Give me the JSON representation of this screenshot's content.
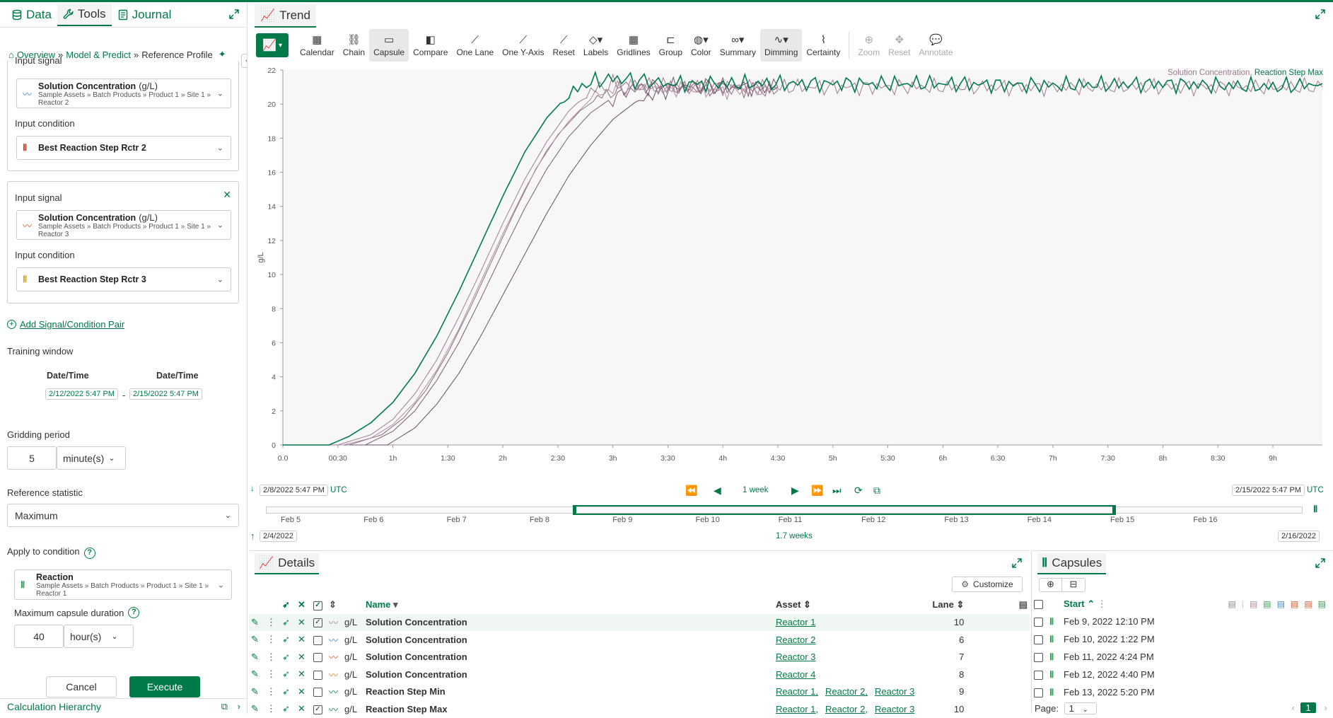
{
  "left": {
    "tabs": [
      {
        "label": "Data"
      },
      {
        "label": "Tools"
      },
      {
        "label": "Journal"
      }
    ],
    "breadcrumb": {
      "overview": "Overview",
      "model": "Model & Predict",
      "sep": "»",
      "current": "Reference Profile"
    },
    "card1": {
      "input_signal_label": "Input signal",
      "signal_name": "Solution Concentration",
      "signal_unit": "(g/L)",
      "signal_path": "Sample Assets » Batch Products » Product 1 » Site 1 » Reactor 2",
      "input_condition_label": "Input condition",
      "condition_name": "Best Reaction Step Rctr 2"
    },
    "card2": {
      "input_signal_label": "Input signal",
      "signal_name": "Solution Concentration",
      "signal_unit": "(g/L)",
      "signal_path": "Sample Assets » Batch Products » Product 1 » Site 1 » Reactor 3",
      "input_condition_label": "Input condition",
      "condition_name": "Best Reaction Step Rctr 3"
    },
    "add_pair": "Add Signal/Condition Pair",
    "training_window": {
      "label": "Training window",
      "col1": "Date/Time",
      "col2": "Date/Time",
      "start": "2/12/2022 5:47 PM",
      "dash": "-",
      "end": "2/15/2022 5:47 PM"
    },
    "gridding": {
      "label": "Gridding period",
      "value": "5",
      "unit": "minute(s)"
    },
    "reference_statistic": {
      "label": "Reference statistic",
      "value": "Maximum"
    },
    "apply_condition": {
      "label": "Apply to condition",
      "name": "Reaction",
      "path": "Sample Assets » Batch Products » Product 1 » Site 1 » Reactor 1"
    },
    "max_duration": {
      "label": "Maximum capsule duration",
      "value": "40",
      "unit": "hour(s)"
    },
    "cancel": "Cancel",
    "execute": "Execute",
    "calc_hierarchy": "Calculation Hierarchy"
  },
  "trend": {
    "tab_label": "Trend",
    "toolbar": [
      {
        "label": "Calendar",
        "icon": "calendar-icon",
        "glyph": "▦"
      },
      {
        "label": "Chain",
        "icon": "chain-icon",
        "glyph": "⛓"
      },
      {
        "label": "Capsule",
        "icon": "capsule-icon",
        "glyph": "▭",
        "active": true
      },
      {
        "label": "Compare",
        "icon": "compare-icon",
        "glyph": "◧"
      },
      {
        "label": "One Lane",
        "icon": "one-lane-icon",
        "glyph": "⟋"
      },
      {
        "label": "One Y-Axis",
        "icon": "one-y-axis-icon",
        "glyph": "⟋"
      },
      {
        "label": "Reset",
        "icon": "reset-icon",
        "glyph": "⟋"
      },
      {
        "label": "Labels",
        "icon": "labels-icon",
        "glyph": "◇▾"
      },
      {
        "label": "Gridlines",
        "icon": "gridlines-icon",
        "glyph": "▦"
      },
      {
        "label": "Group",
        "icon": "group-icon",
        "glyph": "⊏"
      },
      {
        "label": "Color",
        "icon": "color-icon",
        "glyph": "◍▾"
      },
      {
        "label": "Summary",
        "icon": "summary-icon",
        "glyph": "∞▾"
      },
      {
        "label": "Dimming",
        "icon": "dimming-icon",
        "glyph": "∿▾",
        "active": true
      },
      {
        "label": "Certainty",
        "icon": "certainty-icon",
        "glyph": "⌇"
      }
    ],
    "toolbar2": [
      {
        "label": "Zoom",
        "icon": "zoom-icon",
        "glyph": "⊕"
      },
      {
        "label": "Reset",
        "icon": "pan-reset-icon",
        "glyph": "✥"
      },
      {
        "label": "Annotate",
        "icon": "annotate-icon",
        "glyph": "💬"
      }
    ],
    "legend": {
      "item1": "Solution Concentration",
      "sep": ",",
      "item2": "Reaction Step Max",
      "color1": "#a07a90",
      "color2": "#007a49"
    },
    "nav": {
      "start": "2/8/2022 5:47 PM",
      "tz": "UTC",
      "span": "1 week",
      "end": "2/15/2022 5:47 PM",
      "tz2": "UTC",
      "overall_start": "2/4/2022",
      "overall_end": "2/16/2022",
      "overall_span": "1.7 weeks"
    },
    "overview_ticks": [
      "Feb 5",
      "Feb 6",
      "Feb 7",
      "Feb 8",
      "Feb 9",
      "Feb 10",
      "Feb 11",
      "Feb 12",
      "Feb 13",
      "Feb 14",
      "Feb 15",
      "Feb 16"
    ]
  },
  "chart_data": {
    "type": "line",
    "ylabel": "g/L",
    "ylim": [
      0,
      22
    ],
    "yticks": [
      0,
      2,
      4,
      6,
      8,
      10,
      12,
      14,
      16,
      18,
      20,
      22
    ],
    "xticks": [
      "0.0",
      "00:30",
      "1h",
      "1:30",
      "2h",
      "2:30",
      "3h",
      "3:30",
      "4h",
      "4:30",
      "5h",
      "5:30",
      "6h",
      "6:30",
      "7h",
      "7:30",
      "8h",
      "8:30",
      "9h"
    ],
    "xlim_hours": [
      0,
      9.45
    ],
    "series": [
      {
        "name": "Reaction Step Max",
        "color": "#007a49",
        "x": [
          0,
          0.42,
          0.6,
          0.8,
          1.0,
          1.2,
          1.4,
          1.6,
          1.8,
          2.0,
          2.2,
          2.4,
          2.6,
          2.8,
          3.0,
          3.2,
          3.5,
          4.0,
          5.0,
          6.0,
          7.0,
          8.0,
          9.0,
          9.45
        ],
        "y": [
          0,
          0,
          0.5,
          1.3,
          2.5,
          4.2,
          6.4,
          9.0,
          11.8,
          14.6,
          17.2,
          19.2,
          20.6,
          21.3,
          21.5,
          21.4,
          21.2,
          21.2,
          21.2,
          21.2,
          21.1,
          21.2,
          21.0,
          21.2
        ]
      },
      {
        "name": "Solution Concentration",
        "color": "#a07a90",
        "x": [
          0,
          0.5,
          0.8,
          1.0,
          1.2,
          1.4,
          1.6,
          1.8,
          2.0,
          2.2,
          2.4,
          2.6,
          2.8,
          3.0,
          3.2,
          3.5,
          4.0,
          5.0,
          6.0,
          7.0,
          8.0,
          9.0,
          9.45
        ],
        "y": [
          0,
          0,
          0.6,
          1.5,
          3.0,
          5.0,
          7.5,
          10.2,
          13.0,
          15.6,
          17.8,
          19.6,
          20.8,
          21.2,
          21.1,
          21.0,
          21.0,
          21.0,
          21.0,
          21.0,
          21.0,
          21.0,
          21.0
        ]
      },
      {
        "name": "Solution Concentration",
        "color": "#b08aa0",
        "x": [
          0,
          0.55,
          0.8,
          1.0,
          1.2,
          1.4,
          1.6,
          1.8,
          2.0,
          2.2,
          2.4,
          2.6,
          2.8,
          3.0,
          3.2,
          3.5,
          4.0,
          4.5
        ],
        "y": [
          0,
          0,
          0.4,
          1.2,
          2.5,
          4.4,
          6.8,
          9.6,
          12.4,
          15.0,
          17.3,
          19.0,
          20.3,
          20.9,
          21.0,
          20.9,
          20.8,
          20.8
        ]
      },
      {
        "name": "Solution Concentration",
        "color": "#8a6a80",
        "x": [
          0,
          0.6,
          0.9,
          1.1,
          1.3,
          1.5,
          1.7,
          1.9,
          2.1,
          2.3,
          2.5,
          2.7,
          2.9,
          3.1,
          3.3,
          3.6,
          4.0,
          4.5
        ],
        "y": [
          0,
          0,
          0.6,
          1.6,
          3.2,
          5.4,
          8.0,
          10.8,
          13.6,
          16.2,
          18.2,
          19.6,
          20.5,
          20.9,
          21.0,
          20.9,
          20.9,
          20.8
        ]
      },
      {
        "name": "Solution Concentration",
        "color": "#7a5a70",
        "x": [
          0,
          0.75,
          1.0,
          1.2,
          1.4,
          1.6,
          1.8,
          2.0,
          2.2,
          2.4,
          2.6,
          2.8,
          3.0,
          3.2,
          3.4,
          3.7,
          4.0,
          4.5
        ],
        "y": [
          0,
          0,
          0.8,
          2.0,
          3.8,
          6.0,
          8.6,
          11.3,
          13.9,
          16.2,
          18.1,
          19.5,
          20.4,
          20.9,
          21.1,
          21.0,
          21.0,
          21.0
        ]
      },
      {
        "name": "Solution Concentration",
        "color": "#6a4a60",
        "x": [
          0,
          0.95,
          1.2,
          1.4,
          1.6,
          1.8,
          2.0,
          2.2,
          2.4,
          2.6,
          2.8,
          3.0,
          3.2,
          3.4,
          3.6,
          3.8,
          4.1,
          4.5
        ],
        "y": [
          0,
          0,
          1.0,
          2.4,
          4.2,
          6.4,
          8.8,
          11.2,
          13.6,
          15.8,
          17.6,
          19.1,
          20.1,
          20.7,
          21.0,
          21.1,
          21.0,
          21.0
        ]
      }
    ]
  },
  "details": {
    "tab_label": "Details",
    "customize": "Customize",
    "headers": {
      "name": "Name",
      "asset": "Asset",
      "lane": "Lane"
    },
    "rows": [
      {
        "unit": "g/L",
        "name": "Solution Concentration",
        "assets": [
          "Reactor 1"
        ],
        "lane": "10",
        "checked": true,
        "icon_color": "#a07a90"
      },
      {
        "unit": "g/L",
        "name": "Solution Concentration",
        "assets": [
          "Reactor 2"
        ],
        "lane": "6",
        "checked": false,
        "icon_color": "#3a8fd6"
      },
      {
        "unit": "g/L",
        "name": "Solution Concentration",
        "assets": [
          "Reactor 3"
        ],
        "lane": "7",
        "checked": false,
        "icon_color": "#d65a2a"
      },
      {
        "unit": "g/L",
        "name": "Solution Concentration",
        "assets": [
          "Reactor 4"
        ],
        "lane": "8",
        "checked": false,
        "icon_color": "#d6822a"
      },
      {
        "unit": "g/L",
        "name": "Reaction Step Min",
        "assets": [
          "Reactor 1,",
          "Reactor 2,",
          "Reactor 3"
        ],
        "lane": "9",
        "checked": false,
        "icon_color": "#007a49"
      },
      {
        "unit": "g/L",
        "name": "Reaction Step Max",
        "assets": [
          "Reactor 1,",
          "Reactor 2,",
          "Reactor 3"
        ],
        "lane": "10",
        "checked": true,
        "icon_color": "#007a49"
      }
    ]
  },
  "capsules": {
    "tab_label": "Capsules",
    "start_header": "Start",
    "rows": [
      "Feb 9, 2022 12:10 PM",
      "Feb 10, 2022 1:22 PM",
      "Feb 11, 2022 4:24 PM",
      "Feb 12, 2022 4:40 PM",
      "Feb 13, 2022 5:20 PM"
    ],
    "page_label": "Page:",
    "page_value": "1",
    "page_current": "1"
  }
}
